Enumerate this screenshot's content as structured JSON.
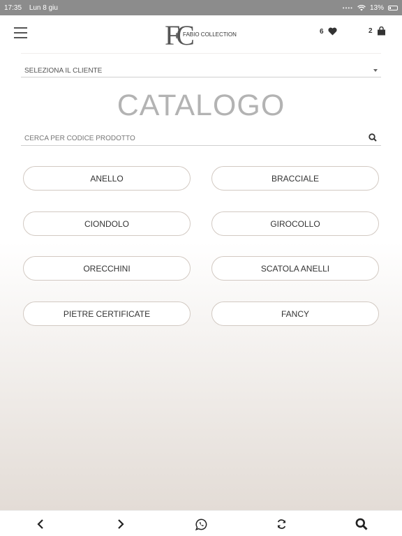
{
  "status_bar": {
    "time": "17:35",
    "date": "Lun 8 giu",
    "battery": "13%"
  },
  "header": {
    "brand_name": "FABIO COLLECTION",
    "logo_letters": "FC",
    "favorites_count": "6",
    "cart_count": "2"
  },
  "client_select": {
    "selected": "SELEZIONA IL CLIENTE"
  },
  "title": "CATALOGO",
  "search": {
    "placeholder": "CERCA PER CODICE PRODOTTO"
  },
  "categories": [
    {
      "label": "ANELLO"
    },
    {
      "label": "BRACCIALE"
    },
    {
      "label": "CIONDOLO"
    },
    {
      "label": "GIROCOLLO"
    },
    {
      "label": "ORECCHINI"
    },
    {
      "label": "SCATOLA ANELLI"
    },
    {
      "label": "PIETRE CERTIFICATE"
    },
    {
      "label": "FANCY"
    }
  ],
  "bottom_bar": {
    "icons": [
      "back-icon",
      "forward-icon",
      "whatsapp-icon",
      "refresh-icon",
      "search-icon"
    ]
  },
  "colors": {
    "status_bar": "#8c8c8c",
    "button_border": "#d2c9c2",
    "title": "#b3b3b3",
    "gradient_end": "#e3dcd6"
  }
}
